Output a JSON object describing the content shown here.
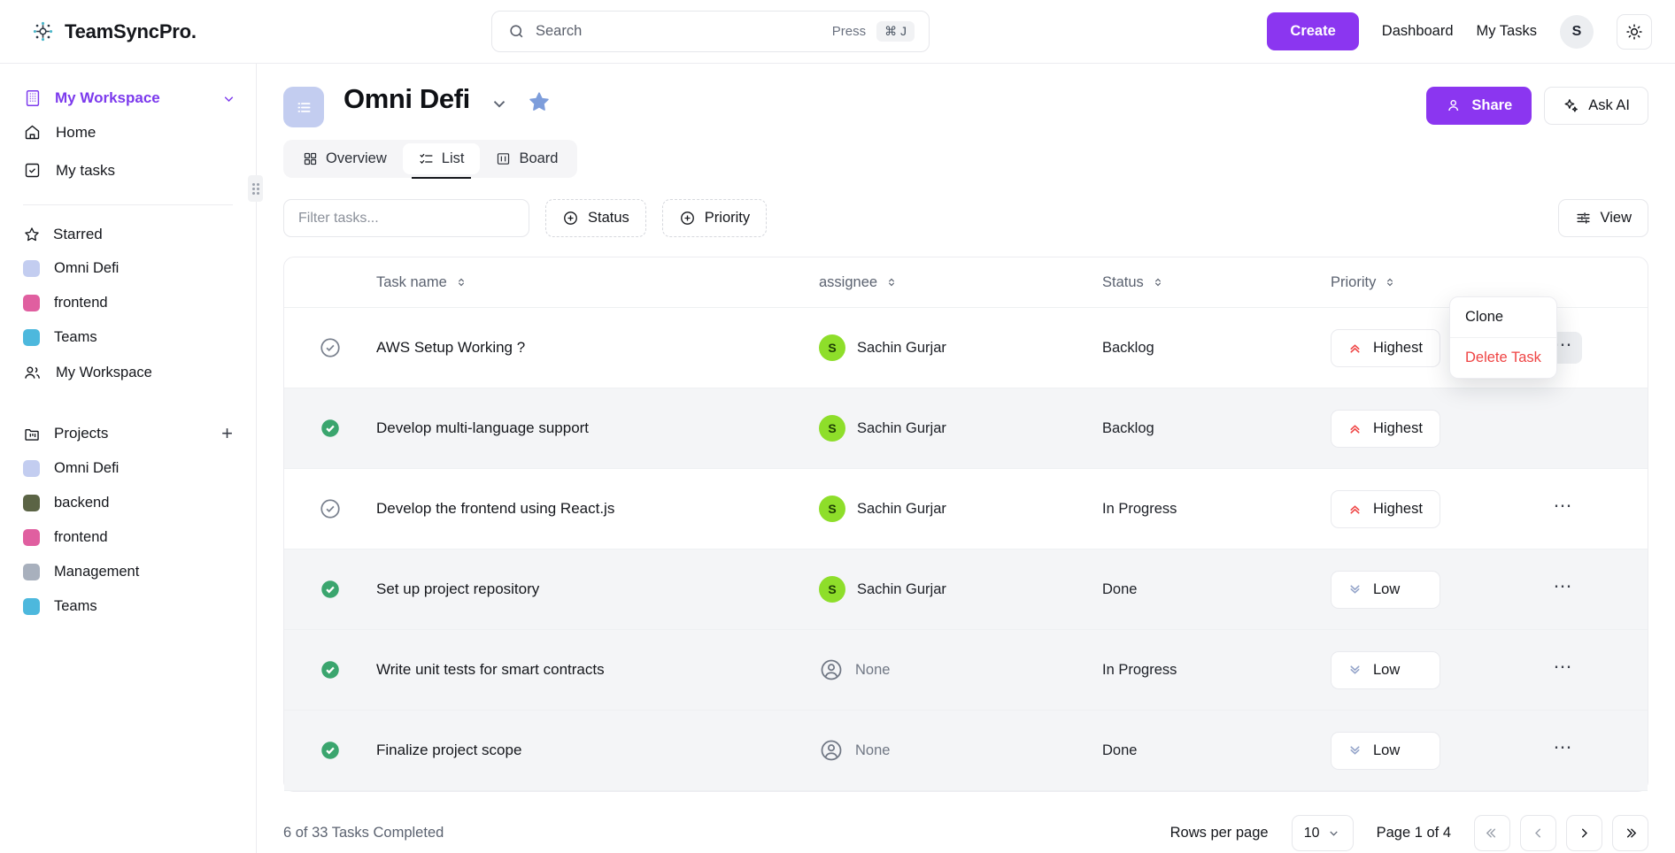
{
  "app": {
    "brand": "TeamSyncPro."
  },
  "search": {
    "placeholder": "Search",
    "value": "",
    "press_label": "Press",
    "kbd": "⌘ J"
  },
  "topbar": {
    "create_label": "Create",
    "dashboard_label": "Dashboard",
    "mytasks_label": "My Tasks",
    "avatar_initial": "S"
  },
  "sidebar": {
    "workspace": "My Workspace",
    "nav": [
      {
        "label": "Home",
        "icon": "home-icon"
      },
      {
        "label": "My tasks",
        "icon": "check-square-icon"
      }
    ],
    "starred_label": "Starred",
    "starred": [
      {
        "label": "Omni Defi",
        "color": "#c3cdf0"
      },
      {
        "label": "frontend",
        "color": "#e05fa0"
      },
      {
        "label": "Teams",
        "color": "#4db8dd"
      }
    ],
    "starred_workspace": "My Workspace",
    "projects_label": "Projects",
    "projects": [
      {
        "label": "Omni Defi",
        "color": "#c3cdf0"
      },
      {
        "label": "backend",
        "color": "#5b6445"
      },
      {
        "label": "frontend",
        "color": "#e05fa0"
      },
      {
        "label": "Management",
        "color": "#a8b0bd"
      },
      {
        "label": "Teams",
        "color": "#4db8dd"
      }
    ]
  },
  "project": {
    "title": "Omni Defi",
    "share_label": "Share",
    "askai_label": "Ask AI",
    "tabs": [
      {
        "label": "Overview",
        "icon": "grid-icon",
        "active": false
      },
      {
        "label": "List",
        "icon": "list-check-icon",
        "active": true
      },
      {
        "label": "Board",
        "icon": "board-icon",
        "active": false
      }
    ]
  },
  "toolbar": {
    "filter_placeholder": "Filter tasks...",
    "filter_value": "",
    "status_chip": "Status",
    "priority_chip": "Priority",
    "view_label": "View"
  },
  "table": {
    "columns": [
      "Task name",
      "assignee",
      "Status",
      "Priority"
    ],
    "rows": [
      {
        "done": false,
        "name": "AWS Setup Working ?",
        "assignee": "Sachin Gurjar",
        "avatar": "S",
        "status": "Backlog",
        "priority": "Highest"
      },
      {
        "done": true,
        "name": "Develop multi-language support",
        "assignee": "Sachin Gurjar",
        "avatar": "S",
        "status": "Backlog",
        "priority": "Highest"
      },
      {
        "done": false,
        "name": "Develop the frontend using React.js",
        "assignee": "Sachin Gurjar",
        "avatar": "S",
        "status": "In Progress",
        "priority": "Highest"
      },
      {
        "done": true,
        "name": "Set up project repository",
        "assignee": "Sachin Gurjar",
        "avatar": "S",
        "status": "Done",
        "priority": "Low"
      },
      {
        "done": true,
        "name": "Write unit tests for smart contracts",
        "assignee": "None",
        "avatar": null,
        "status": "In Progress",
        "priority": "Low"
      },
      {
        "done": true,
        "name": "Finalize project scope",
        "assignee": "None",
        "avatar": null,
        "status": "Done",
        "priority": "Low"
      }
    ]
  },
  "context_menu": {
    "clone": "Clone",
    "delete": "Delete Task"
  },
  "footer": {
    "completed_text": "6 of 33 Tasks Completed",
    "rows_per_page_label": "Rows per page",
    "rows_per_page_value": "10",
    "page_label": "Page 1 of 4"
  },
  "colors": {
    "accent": "#8b36f0",
    "workspace_purple": "#7c3aed",
    "danger": "#ef4444",
    "highest": "#ef4444",
    "low": "#93a3c9",
    "done_green": "#3aa56e",
    "avatar_green": "#8ede2a"
  }
}
